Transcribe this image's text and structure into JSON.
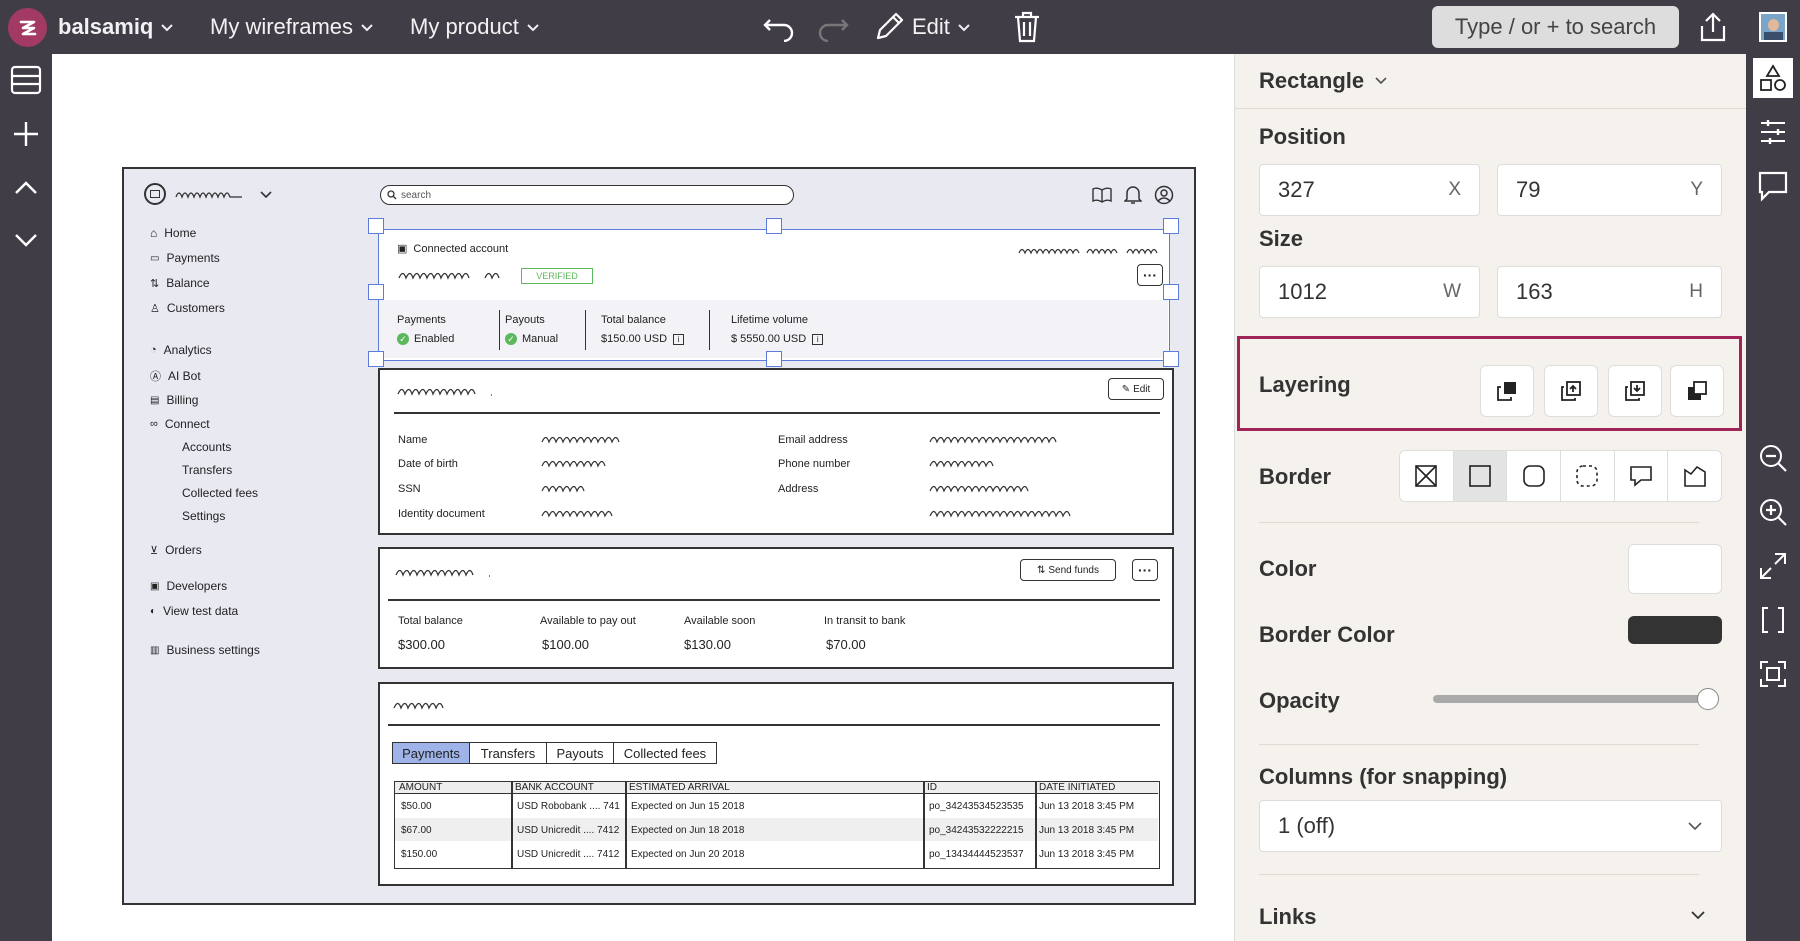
{
  "topbar": {
    "brand": "balsamiq",
    "menu1": "My wireframes",
    "menu2": "My product",
    "edit_label": "Edit",
    "search_placeholder": "Type / or + to search"
  },
  "panel": {
    "element_type": "Rectangle",
    "position_label": "Position",
    "x_value": "327",
    "x_suffix": "X",
    "y_value": "79",
    "y_suffix": "Y",
    "size_label": "Size",
    "w_value": "1012",
    "w_suffix": "W",
    "h_value": "163",
    "h_suffix": "H",
    "layering_label": "Layering",
    "border_label": "Border",
    "color_label": "Color",
    "color_value": "#ffffff",
    "border_color_label": "Border Color",
    "border_color_value": "#333333",
    "opacity_label": "Opacity",
    "opacity_value": 1.0,
    "columns_label": "Columns (for snapping)",
    "columns_value": "1 (off)",
    "links_label": "Links",
    "highlight_color": "#a0245a"
  },
  "wireframe": {
    "search_placeholder": "search",
    "nav": [
      "Home",
      "Payments",
      "Balance",
      "Customers",
      "Analytics",
      "AI Bot",
      "Billing",
      "Connect"
    ],
    "nav_sub": [
      "Accounts",
      "Transfers",
      "Collected fees",
      "Settings"
    ],
    "nav_bottom": [
      "Orders",
      "Developers",
      "View test data",
      "Business settings"
    ],
    "connected_account": "Connected account",
    "verified": "VERIFIED",
    "stats": [
      {
        "label": "Payments",
        "value": "Enabled"
      },
      {
        "label": "Payouts",
        "value": "Manual"
      },
      {
        "label": "Total balance",
        "value": "$150.00 USD"
      },
      {
        "label": "Lifetime volume",
        "value": "$ 5550.00 USD"
      }
    ],
    "edit_button": "Edit",
    "details": {
      "left_labels": [
        "Name",
        "Date of birth",
        "SSN",
        "Identity document"
      ],
      "right_labels": [
        "Email address",
        "Phone number",
        "Address"
      ]
    },
    "send_funds": "Send funds",
    "balances": [
      {
        "label": "Total balance",
        "value": "$300.00"
      },
      {
        "label": "Available to pay out",
        "value": "$100.00"
      },
      {
        "label": "Available soon",
        "value": "$130.00"
      },
      {
        "label": "In transit to bank",
        "value": "$70.00"
      }
    ],
    "tabs": [
      "Payments",
      "Transfers",
      "Payouts",
      "Collected fees"
    ],
    "table_headers": [
      "AMOUNT",
      "BANK ACCOUNT",
      "ESTIMATED ARRIVAL",
      "ID",
      "DATE INITIATED"
    ],
    "table_rows": [
      [
        "$50.00",
        "USD Robobank .... 741",
        "Expected on Jun 15 2018",
        "po_34243534523535",
        "Jun 13 2018 3:45 PM"
      ],
      [
        "$67.00",
        "USD Unicredit .... 7412",
        "Expected on Jun 18 2018",
        "po_34243532222215",
        "Jun 13 2018 3:45 PM"
      ],
      [
        "$150.00",
        "USD Unicredit .... 7412",
        "Expected on Jun 20 2018",
        "po_13434444523537",
        "Jun 13 2018 3:45 PM"
      ]
    ]
  }
}
